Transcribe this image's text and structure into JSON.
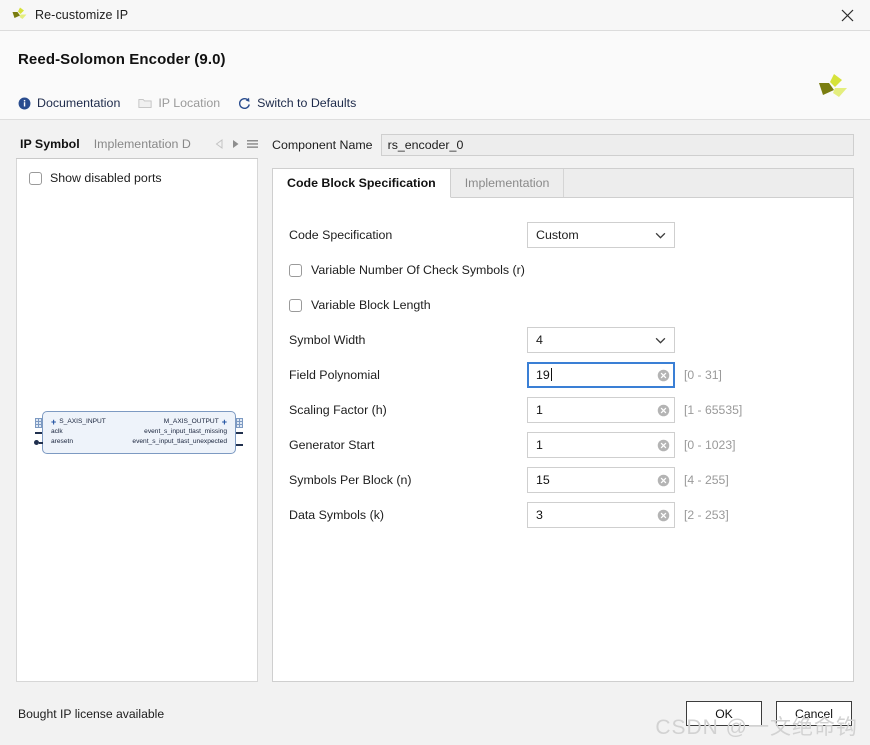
{
  "window": {
    "title": "Re-customize IP",
    "close_icon": "close-icon",
    "app_logo": "xilinx-logo-icon"
  },
  "header": {
    "title": "Reed-Solomon Encoder (9.0)",
    "logo": "xilinx-logo-icon",
    "toolbar": [
      {
        "label": "Documentation",
        "icon": "info-circle-icon",
        "disabled": false
      },
      {
        "label": "IP Location",
        "icon": "folder-icon",
        "disabled": true
      },
      {
        "label": "Switch to Defaults",
        "icon": "refresh-icon",
        "disabled": false
      }
    ]
  },
  "left_panel": {
    "tabs": [
      {
        "label": "IP Symbol",
        "active": true
      },
      {
        "label": "Implementation D",
        "active": false
      }
    ],
    "nav": {
      "prev_icon": "chevron-left-icon",
      "next_icon": "chevron-right-icon",
      "menu_icon": "hamburger-menu-icon"
    },
    "show_disabled_ports": {
      "label": "Show disabled ports",
      "checked": false
    },
    "ip_symbol": {
      "left_ports": [
        "S_AXIS_INPUT",
        "aclk",
        "aresetn"
      ],
      "right_ports": [
        "M_AXIS_OUTPUT",
        "event_s_input_tlast_missing",
        "event_s_input_tlast_unexpected"
      ]
    }
  },
  "main": {
    "component_name": {
      "label": "Component Name",
      "value": "rs_encoder_0"
    },
    "tabs": [
      {
        "label": "Code Block Specification",
        "active": true
      },
      {
        "label": "Implementation",
        "active": false
      }
    ],
    "fields": [
      {
        "type": "select",
        "label": "Code Specification",
        "value": "Custom",
        "range": ""
      },
      {
        "type": "checkbox",
        "label": "Variable Number Of Check Symbols (r)",
        "checked": false
      },
      {
        "type": "checkbox",
        "label": "Variable Block Length",
        "checked": false
      },
      {
        "type": "select",
        "label": "Symbol Width",
        "value": "4",
        "range": ""
      },
      {
        "type": "text",
        "label": "Field Polynomial",
        "value": "19",
        "range": "[0 - 31]",
        "focused": true
      },
      {
        "type": "text",
        "label": "Scaling Factor (h)",
        "value": "1",
        "range": "[1 - 65535]",
        "focused": false
      },
      {
        "type": "text",
        "label": "Generator Start",
        "value": "1",
        "range": "[0 - 1023]",
        "focused": false
      },
      {
        "type": "text",
        "label": "Symbols Per Block (n)",
        "value": "15",
        "range": "[4 - 255]",
        "focused": false
      },
      {
        "type": "text",
        "label": "Data Symbols (k)",
        "value": "3",
        "range": "[2 - 253]",
        "focused": false
      }
    ]
  },
  "footer": {
    "license_text": "Bought IP license available",
    "ok_label": "OK",
    "cancel_label": "Cancel",
    "watermark": "CSDN @一文绝命钩"
  },
  "colors": {
    "accent_blue": "#3a7fd5",
    "link_blue": "#1d2a4a",
    "logo_green": "#c8d92b",
    "logo_olive": "#7a7d10",
    "panel_bg": "#f2f2f2"
  }
}
